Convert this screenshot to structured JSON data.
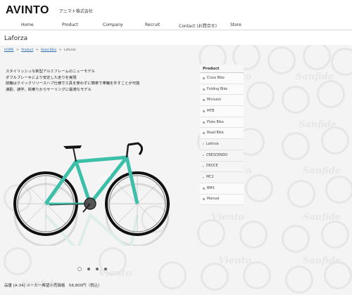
{
  "brand": {
    "logo": "AVINTO",
    "logo_accent": "O",
    "sub": "アニマト株式会社"
  },
  "nav": {
    "items": [
      "Home",
      "Product",
      "Company",
      "Recruit",
      "Contact (お問合せ)",
      "Store"
    ]
  },
  "page": {
    "title": "Laforza"
  },
  "breadcrumb": {
    "home": "HOME",
    "sep1": ">",
    "product": "Product",
    "sep2": ">",
    "road": "Road Bike",
    "sep3": ">",
    "current": "Laforza"
  },
  "description": [
    "スタイリッシュな新型アルミフレームのニューモデル",
    "ダブルブレーキにより安定した走りを実現",
    "前輪はクイックリリースハブ仕様で工具を使わずに簡単で車輪を外すことが可能",
    "通勤、通学、街乗りからサーリングに最適なモデル"
  ],
  "bike": {
    "frame_text": "Laforza",
    "frame_color": "#3bbfa9"
  },
  "carousel": {
    "count": 4,
    "active": 0
  },
  "price": "品番 [A-34] メーカー希望小売価格　58,800円（税込）",
  "sidebar": {
    "heading": "Product",
    "items": [
      {
        "label": "Cross Bike",
        "type": "main"
      },
      {
        "label": "Folding Bike",
        "type": "main"
      },
      {
        "label": "Minivelo",
        "type": "main"
      },
      {
        "label": "MTB",
        "type": "main"
      },
      {
        "label": "Plate Bike",
        "type": "main"
      },
      {
        "label": "Road Bike",
        "type": "main"
      },
      {
        "label": "Laforza",
        "type": "sub"
      },
      {
        "label": "CRESCENDO",
        "type": "sub"
      },
      {
        "label": "DEUCE",
        "type": "sub"
      },
      {
        "label": "MC2",
        "type": "sub"
      },
      {
        "label": "BMX",
        "type": "main"
      },
      {
        "label": "Manual",
        "type": "main"
      }
    ]
  },
  "watermark": {
    "word1": "Viento",
    "word2": "Sanfide"
  }
}
